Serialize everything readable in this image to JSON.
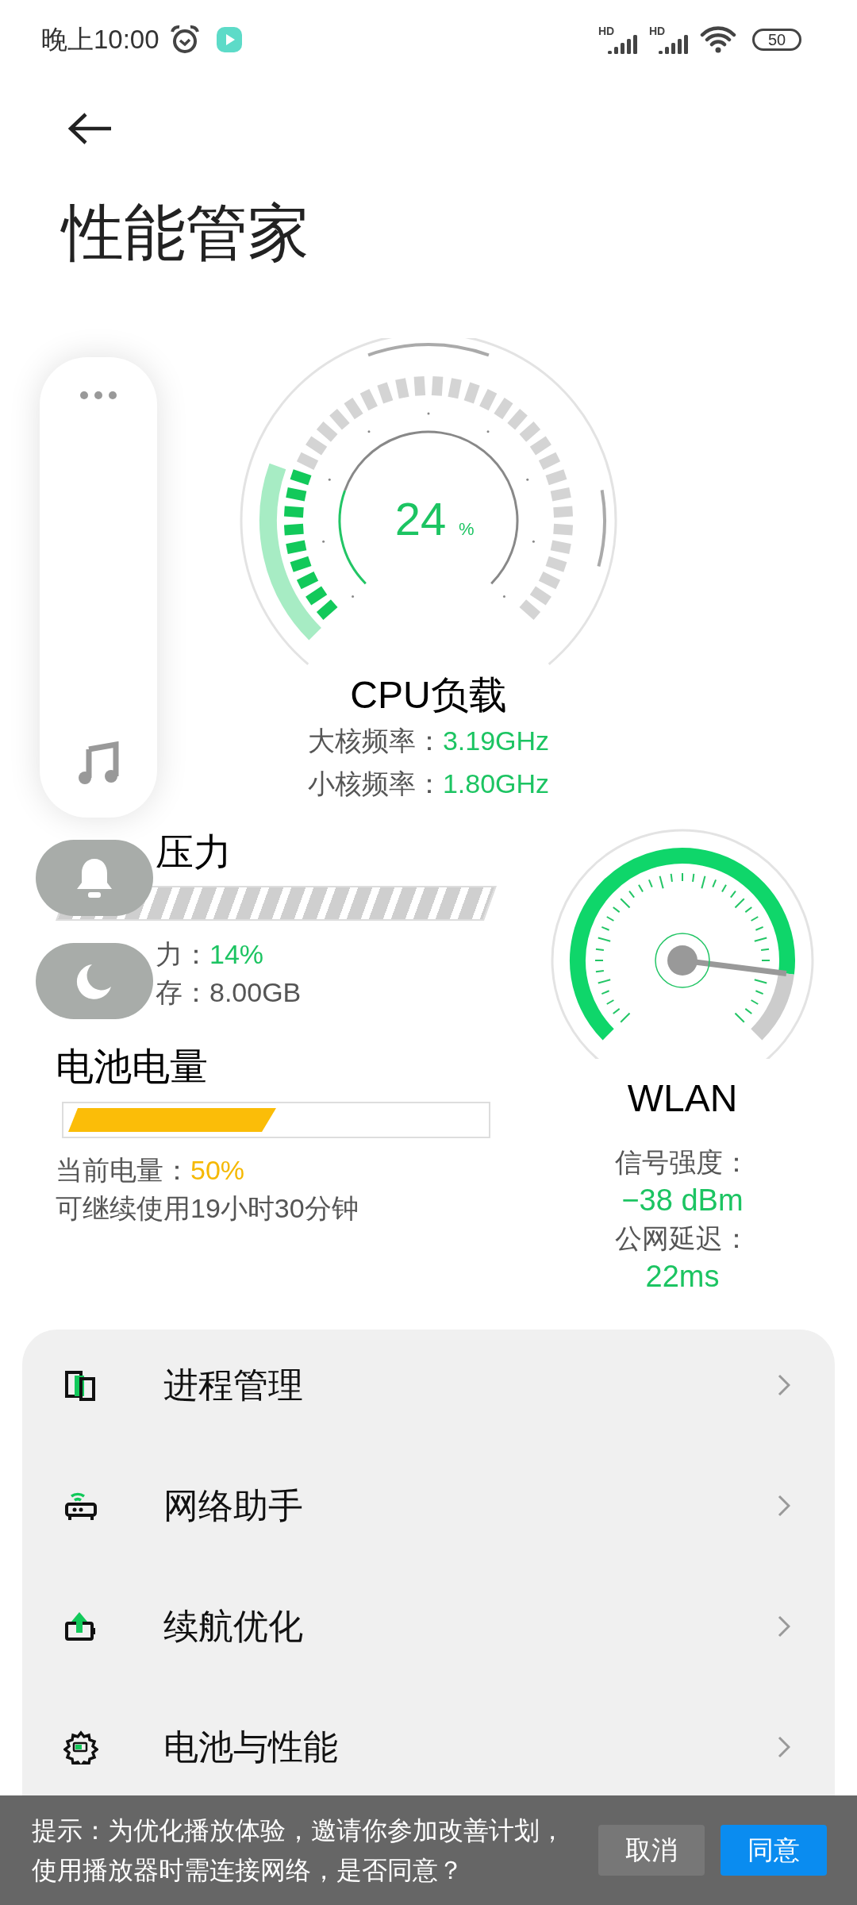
{
  "status_bar": {
    "time": "晚上10:00",
    "sim_labels": [
      "HD",
      "HD"
    ],
    "battery": "50"
  },
  "title": "性能管家",
  "cpu": {
    "percent": "24",
    "unit": "%",
    "title": "CPU负载",
    "lines": [
      {
        "label": "大核频率：",
        "value": "3.19GHz"
      },
      {
        "label": "小核频率：",
        "value": "1.80GHz"
      }
    ]
  },
  "memory": {
    "title": "压力",
    "lines": [
      {
        "label": "力：",
        "value": "14%",
        "highlighted": true
      },
      {
        "label": "存：",
        "value": "8.00GB",
        "highlighted": false
      }
    ]
  },
  "battery": {
    "title": "电池电量",
    "level": 0.5,
    "lines": [
      {
        "label": "当前电量：",
        "value": "50%"
      }
    ],
    "note": "可继续使用19小时30分钟"
  },
  "wlan": {
    "title": "WLAN",
    "signal_label": "信号强度：",
    "signal_value": "−38 dBm",
    "latency_label": "公网延迟：",
    "latency_value": "22ms"
  },
  "menu": [
    {
      "kind": "process",
      "label": "进程管理"
    },
    {
      "kind": "network",
      "label": "网络助手"
    },
    {
      "kind": "endurance",
      "label": "续航优化"
    },
    {
      "kind": "performance",
      "label": "电池与性能"
    }
  ],
  "banner": {
    "message": "提示：为优化播放体验，邀请你参加改善计划，使用播放器时需连接网络，是否同意？",
    "buttons": [
      {
        "label": "取消",
        "kind": "secondary"
      },
      {
        "label": "同意",
        "kind": "primary"
      }
    ]
  }
}
